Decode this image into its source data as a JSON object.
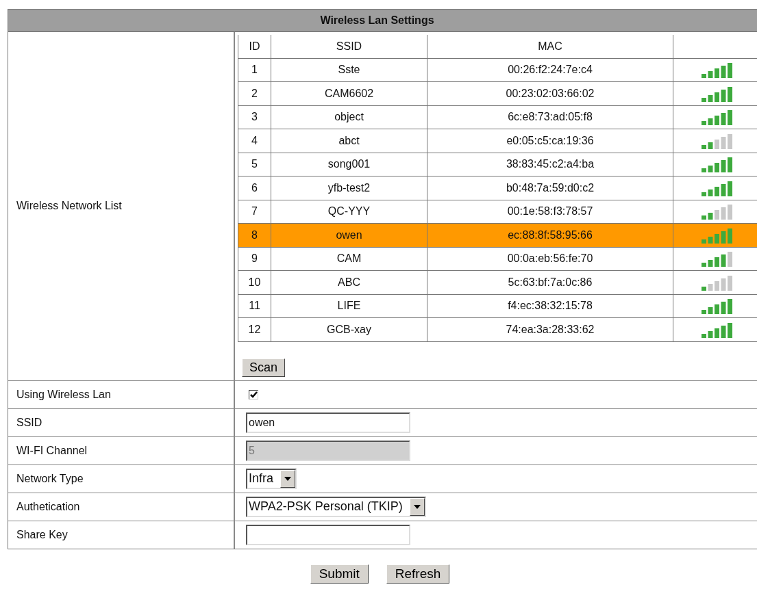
{
  "title": "Wireless Lan Settings",
  "network_list": {
    "label": "Wireless Network List",
    "columns": [
      "ID",
      "SSID",
      "MAC"
    ],
    "rows": [
      {
        "id": "1",
        "ssid": "Sste",
        "mac": "00:26:f2:24:7e:c4",
        "level": 1,
        "selected": false
      },
      {
        "id": "2",
        "ssid": "CAM6602",
        "mac": "00:23:02:03:66:02",
        "level": 1,
        "selected": false
      },
      {
        "id": "3",
        "ssid": "object",
        "mac": "6c:e8:73:ad:05:f8",
        "level": 1,
        "selected": false
      },
      {
        "id": "4",
        "ssid": "abct",
        "mac": "e0:05:c5:ca:19:36",
        "level": 0.4,
        "selected": false
      },
      {
        "id": "5",
        "ssid": "song001",
        "mac": "38:83:45:c2:a4:ba",
        "level": 1,
        "selected": false
      },
      {
        "id": "6",
        "ssid": "yfb-test2",
        "mac": "b0:48:7a:59:d0:c2",
        "level": 1,
        "selected": false
      },
      {
        "id": "7",
        "ssid": "QC-YYY",
        "mac": "00:1e:58:f3:78:57",
        "level": 0.4,
        "selected": false
      },
      {
        "id": "8",
        "ssid": "owen",
        "mac": "ec:88:8f:58:95:66",
        "level": 1,
        "selected": true
      },
      {
        "id": "9",
        "ssid": "CAM",
        "mac": "00:0a:eb:56:fe:70",
        "level": 0.8,
        "selected": false
      },
      {
        "id": "10",
        "ssid": "ABC",
        "mac": "5c:63:bf:7a:0c:86",
        "level": 0.2,
        "selected": false
      },
      {
        "id": "11",
        "ssid": "LIFE",
        "mac": "f4:ec:38:32:15:78",
        "level": 1,
        "selected": false
      },
      {
        "id": "12",
        "ssid": "GCB-xay",
        "mac": "74:ea:3a:28:33:62",
        "level": 1,
        "selected": false
      }
    ],
    "scan_button": "Scan"
  },
  "fields": [
    {
      "kind": "checkbox",
      "label": "Using Wireless Lan",
      "checked": true
    },
    {
      "kind": "text",
      "label": "SSID",
      "value": "owen",
      "disabled": false
    },
    {
      "kind": "text",
      "label": "WI-FI Channel",
      "value": "5",
      "disabled": true
    },
    {
      "kind": "select",
      "label": "Network Type",
      "value": "Infra"
    },
    {
      "kind": "select",
      "label": "Authetication",
      "value": "WPA2-PSK Personal (TKIP)"
    },
    {
      "kind": "text",
      "label": "Share Key",
      "disabled": false
    }
  ],
  "buttons": [
    "Submit",
    "Refresh"
  ]
}
